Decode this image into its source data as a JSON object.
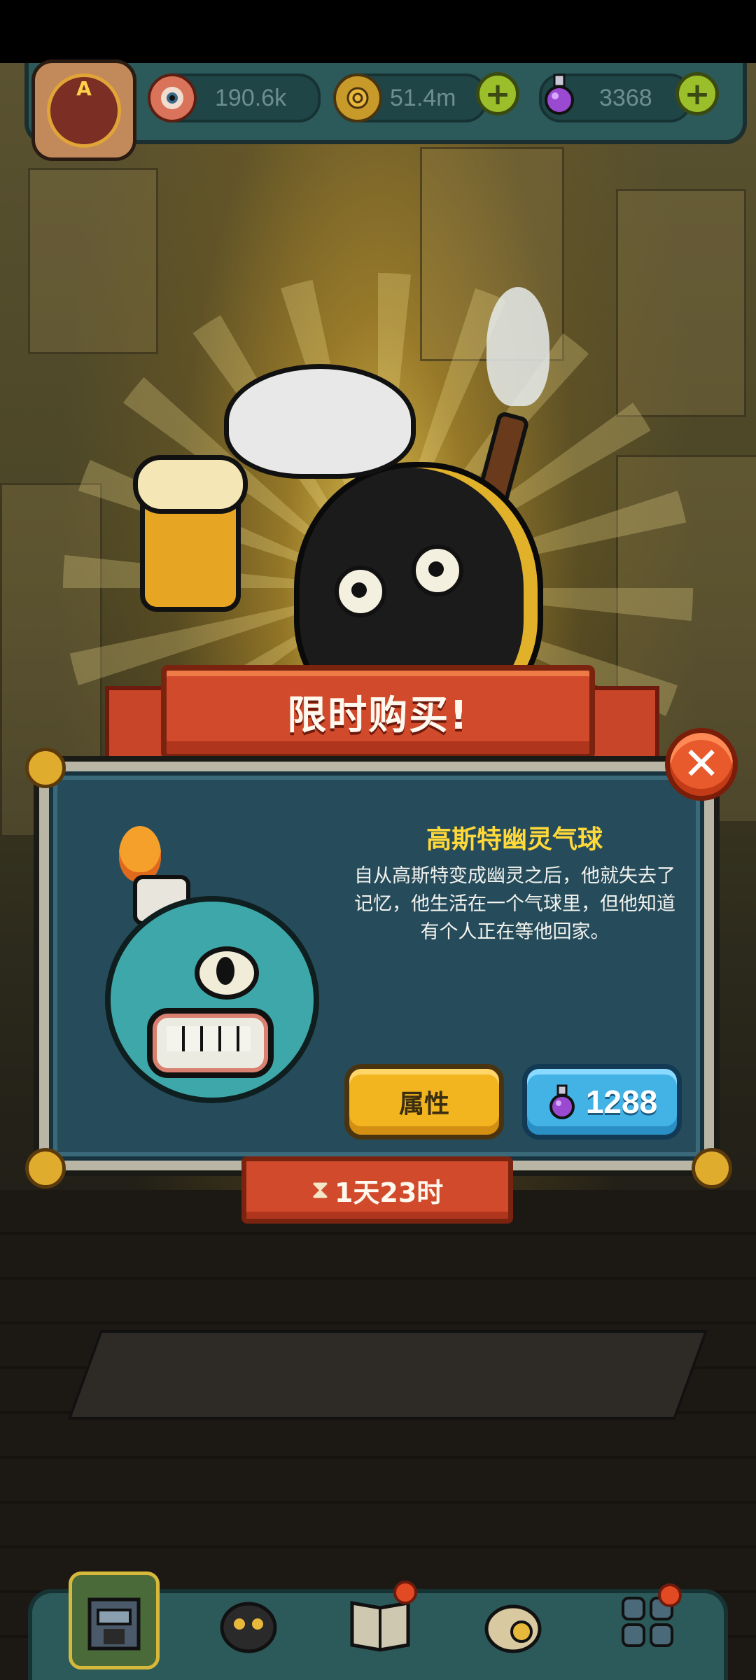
{
  "top_bar": {
    "resources": [
      {
        "icon": "eyeball-icon",
        "value": "190.6k"
      },
      {
        "icon": "coin-icon",
        "value": "51.4m"
      },
      {
        "icon": "potion-icon",
        "value": "3368"
      }
    ],
    "rank_letter": "A"
  },
  "banner": {
    "title": "限时购买!"
  },
  "offer": {
    "name": "高斯特幽灵气球",
    "description": "自从高斯特变成幽灵之后，他就失去了记忆，他生活在一个气球里，但他知道有个人正在等他回家。",
    "attributes_label": "属性",
    "price": "1288",
    "timer": "1天23时"
  },
  "bottom_nav": {
    "items": [
      {
        "icon": "dungeon-machine-icon",
        "active": true
      },
      {
        "icon": "monster-icon",
        "active": false
      },
      {
        "icon": "book-icon",
        "active": false
      },
      {
        "icon": "loot-bag-icon",
        "active": false
      },
      {
        "icon": "grid-menu-icon",
        "active": false
      }
    ]
  },
  "colors": {
    "accent_red": "#d24a2c",
    "gold": "#f2b51f",
    "blue": "#43b3e6",
    "panel": "#264c5c"
  }
}
